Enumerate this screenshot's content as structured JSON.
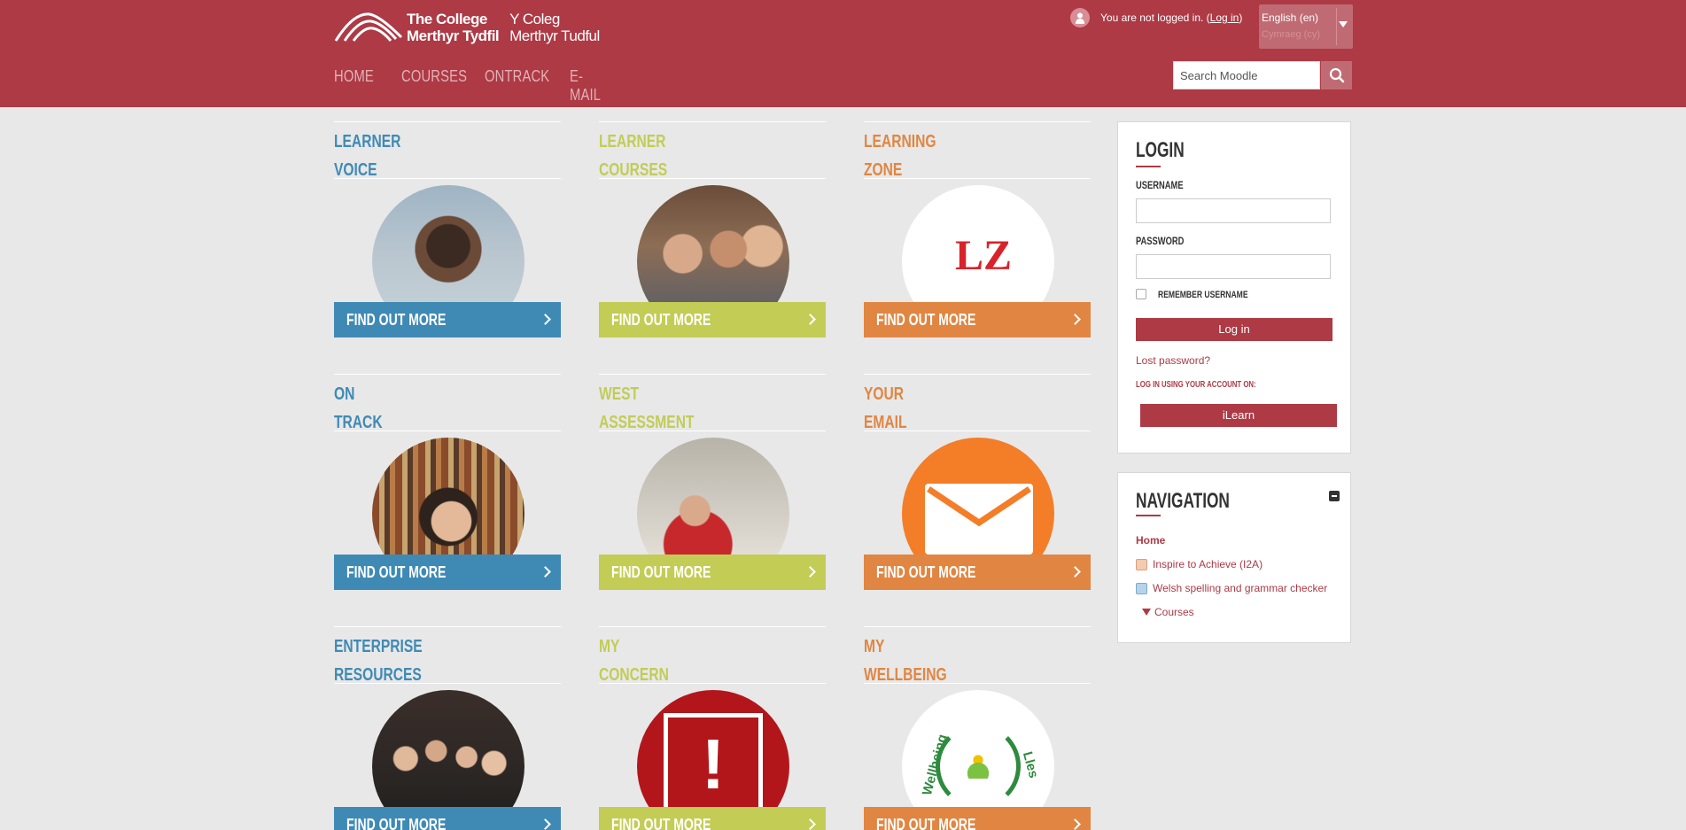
{
  "header": {
    "logo_en_line1": "The College",
    "logo_en_line2": "Merthyr Tydfil",
    "logo_cy_line1": "Y Coleg",
    "logo_cy_line2": "Merthyr Tudful",
    "login_text": "You are not logged in. (",
    "login_link": "Log in",
    "login_close": ")",
    "language_current": "English (en)",
    "language_alt": "Cymraeg (cy)",
    "search_placeholder": "Search Moodle"
  },
  "nav": [
    "HOME",
    "COURSES",
    "ONTRACK",
    "E-MAIL"
  ],
  "tiles": [
    {
      "line1": "LEARNER",
      "line2": "VOICE",
      "button": "FIND OUT MORE",
      "color": "blue",
      "image": "student-photo"
    },
    {
      "line1": "LEARNER",
      "line2": "COURSES",
      "button": "FIND OUT MORE",
      "color": "green",
      "image": "students-group-photo"
    },
    {
      "line1": "LEARNING",
      "line2": "ZONE",
      "button": "FIND OUT MORE",
      "color": "orange",
      "image": "learning-zone-logo"
    },
    {
      "line1": "ON",
      "line2": "TRACK",
      "button": "FIND OUT MORE",
      "color": "blue",
      "image": "library-student-photo"
    },
    {
      "line1": "WEST",
      "line2": "ASSESSMENT",
      "button": "FIND OUT MORE",
      "color": "green",
      "image": "student-writing-photo"
    },
    {
      "line1": "YOUR",
      "line2": "EMAIL",
      "button": "FIND OUT MORE",
      "color": "orange",
      "image": "envelope-icon"
    },
    {
      "line1": "ENTERPRISE",
      "line2": "RESOURCES",
      "button": "FIND OUT MORE",
      "color": "blue",
      "image": "enterprise-group-photo"
    },
    {
      "line1": "MY",
      "line2": "CONCERN",
      "button": "FIND OUT MORE",
      "color": "green",
      "image": "exclamation-icon"
    },
    {
      "line1": "MY",
      "line2": "WELLBEING",
      "button": "FIND OUT MORE",
      "color": "orange",
      "image": "wellbeing-logo"
    }
  ],
  "wellbeing_logo": {
    "left": "Wellbeing",
    "right": "Lles"
  },
  "login_block": {
    "title": "LOGIN",
    "username_label": "USERNAME",
    "password_label": "PASSWORD",
    "remember_label": "REMEMBER USERNAME",
    "login_button": "Log in",
    "lost_password": "Lost password?",
    "sso_label": "LOG IN USING YOUR ACCOUNT ON:",
    "sso_button": "iLearn"
  },
  "navigation_block": {
    "title": "NAVIGATION",
    "items": [
      "Home",
      "Inspire to Achieve (I2A)",
      "Welsh spelling and grammar checker",
      "Courses"
    ]
  },
  "colors": {
    "brand": "#ad3a45",
    "blue": "#3f8ab5",
    "green": "#c3cc55",
    "orange": "#e08642"
  }
}
